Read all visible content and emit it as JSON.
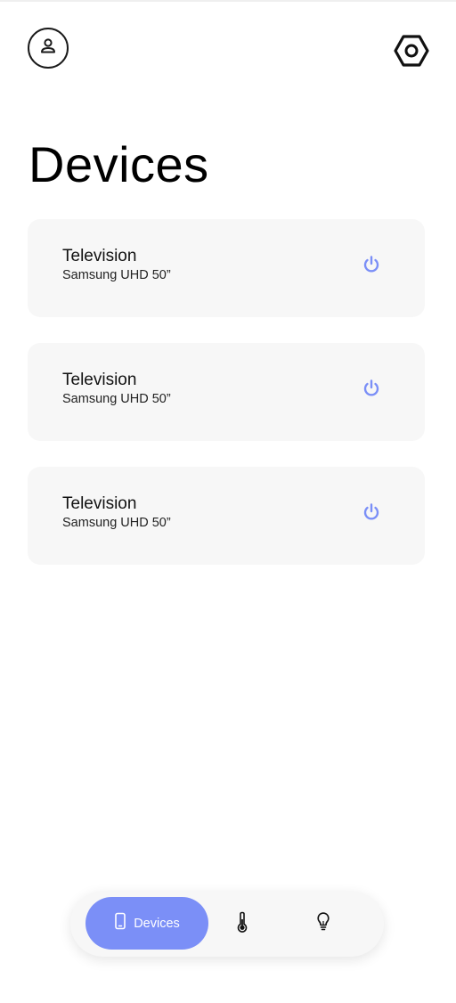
{
  "header": {
    "profile_icon": "person-icon",
    "settings_icon": "hexagon-settings-icon"
  },
  "page": {
    "title": "Devices"
  },
  "devices": [
    {
      "name": "Television",
      "model": "Samsung UHD 50”",
      "action_icon": "power-icon"
    },
    {
      "name": "Television",
      "model": "Samsung UHD 50”",
      "action_icon": "power-icon"
    },
    {
      "name": "Television",
      "model": "Samsung UHD 50”",
      "action_icon": "power-icon"
    }
  ],
  "bottom_nav": {
    "active": {
      "label": "Devices",
      "icon": "phone-icon"
    },
    "items": [
      {
        "icon": "thermometer-icon"
      },
      {
        "icon": "lightbulb-icon"
      }
    ]
  },
  "colors": {
    "accent": "#7b8ff7",
    "card_bg": "#f7f7f7",
    "text": "#111111"
  }
}
